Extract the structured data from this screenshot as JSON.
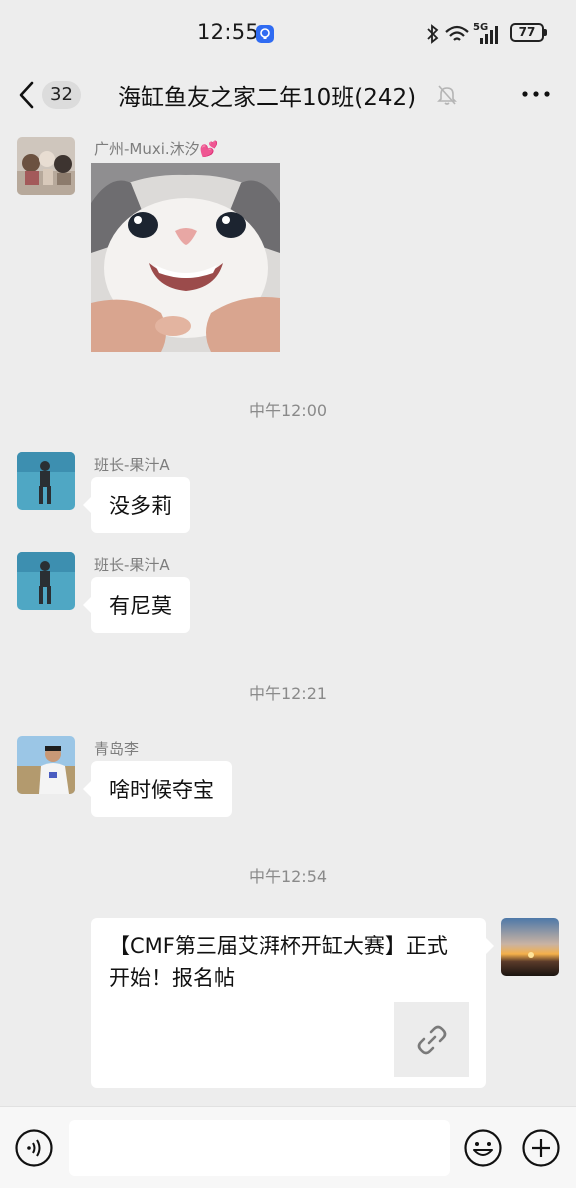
{
  "status_bar": {
    "time": "12:55",
    "network_label": "5G",
    "battery": "77"
  },
  "header": {
    "back_icon": "chevron-left-icon",
    "unread_count": "32",
    "title": "海缸鱼友之家二年10班(242)",
    "mute_icon": "bell-off-icon",
    "more_icon": "more-dots-icon"
  },
  "messages": [
    {
      "sender": "广州-Muxi.沐汐💕",
      "type": "image",
      "content": "cat-smile-sticker"
    },
    {
      "type": "time",
      "text": "中午12:00"
    },
    {
      "sender": "班长-果汁A",
      "type": "text",
      "text": "没多莉"
    },
    {
      "sender": "班长-果汁A",
      "type": "text",
      "text": "有尼莫"
    },
    {
      "type": "time",
      "text": "中午12:21"
    },
    {
      "sender": "青岛李",
      "type": "text",
      "text": "啥时候夺宝"
    },
    {
      "type": "time",
      "text": "中午12:54"
    },
    {
      "sender": "self",
      "type": "link-card",
      "title": "【CMF第三届艾湃杯开缸大赛】正式开始！报名帖",
      "icon": "link-icon"
    }
  ],
  "input_bar": {
    "voice_icon": "voice-icon",
    "input_value": "",
    "emoji_icon": "emoji-icon",
    "plus_icon": "plus-icon"
  }
}
